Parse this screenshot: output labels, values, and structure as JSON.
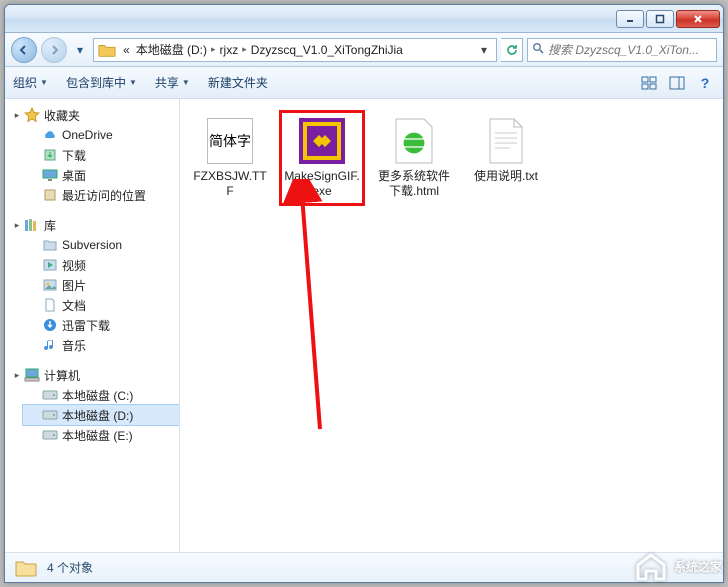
{
  "titlebar": {
    "minimize": "minimize",
    "maximize": "maximize",
    "close": "close"
  },
  "breadcrumb": {
    "prefix": "«",
    "seg1": "本地磁盘 (D:)",
    "seg2": "rjxz",
    "seg3": "Dzyzscq_V1.0_XiTongZhiJia"
  },
  "search": {
    "placeholder": "搜索 Dzyzscq_V1.0_XiTon..."
  },
  "toolbar": {
    "organize": "组织",
    "include": "包含到库中",
    "share": "共享",
    "newfolder": "新建文件夹"
  },
  "sidebar": {
    "favorites": {
      "label": "收藏夹"
    },
    "fav_items": [
      {
        "label": "OneDrive",
        "name": "onedrive"
      },
      {
        "label": "下载",
        "name": "downloads"
      },
      {
        "label": "桌面",
        "name": "desktop"
      },
      {
        "label": "最近访问的位置",
        "name": "recent"
      }
    ],
    "libraries": {
      "label": "库"
    },
    "lib_items": [
      {
        "label": "Subversion",
        "name": "subversion"
      },
      {
        "label": "视频",
        "name": "videos"
      },
      {
        "label": "图片",
        "name": "pictures"
      },
      {
        "label": "文档",
        "name": "documents"
      },
      {
        "label": "迅雷下载",
        "name": "xunlei"
      },
      {
        "label": "音乐",
        "name": "music"
      }
    ],
    "computer": {
      "label": "计算机"
    },
    "drives": [
      {
        "label": "本地磁盘 (C:)",
        "name": "drive-c"
      },
      {
        "label": "本地磁盘 (D:)",
        "name": "drive-d",
        "selected": true
      },
      {
        "label": "本地磁盘 (E:)",
        "name": "drive-e"
      }
    ]
  },
  "files": [
    {
      "label": "FZXBSJW.TTF",
      "kind": "font",
      "thumb_text": "简体字"
    },
    {
      "label": "MakeSignGIF.exe",
      "kind": "exe",
      "highlighted": true
    },
    {
      "label": "更多系统软件下载.html",
      "kind": "html"
    },
    {
      "label": "使用说明.txt",
      "kind": "txt"
    }
  ],
  "status": {
    "count_text": "4 个对象"
  },
  "watermark": {
    "text": "系统之家"
  },
  "annotation": {
    "color": "#e11"
  }
}
